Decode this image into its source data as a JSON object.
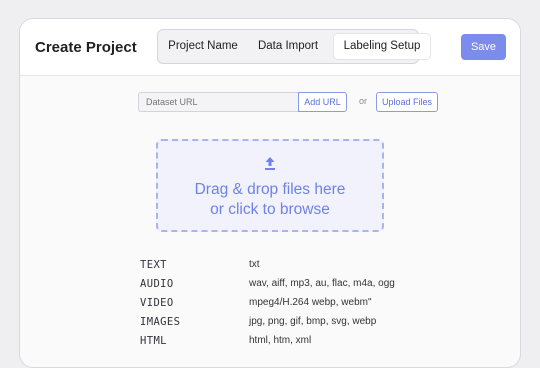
{
  "header": {
    "title": "Create Project",
    "tabs": [
      "Project Name",
      "Data Import",
      "Labeling Setup"
    ],
    "active_tab": "Labeling Setup",
    "save_label": "Save"
  },
  "import": {
    "url_placeholder": "Dataset URL",
    "add_url_label": "Add URL",
    "or_label": "or",
    "upload_label": "Upload Files"
  },
  "dropzone": {
    "line1": "Drag & drop files here",
    "line2": "or click to browse",
    "icon": "upload-arrow-icon"
  },
  "file_types": [
    {
      "type": "TEXT",
      "ext": "txt"
    },
    {
      "type": "AUDIO",
      "ext": "wav, aiff, mp3, au, flac, m4a, ogg"
    },
    {
      "type": "VIDEO",
      "ext": "mpeg4/H.264 webp, webm\""
    },
    {
      "type": "IMAGES",
      "ext": "jpg, png, gif, bmp, svg, webp"
    },
    {
      "type": "HTML",
      "ext": "html, htm, xml"
    }
  ],
  "colors": {
    "accent": "#7b8cec",
    "dropzone_bg": "#f1f2fc",
    "dropzone_border": "#a9b3ee"
  }
}
